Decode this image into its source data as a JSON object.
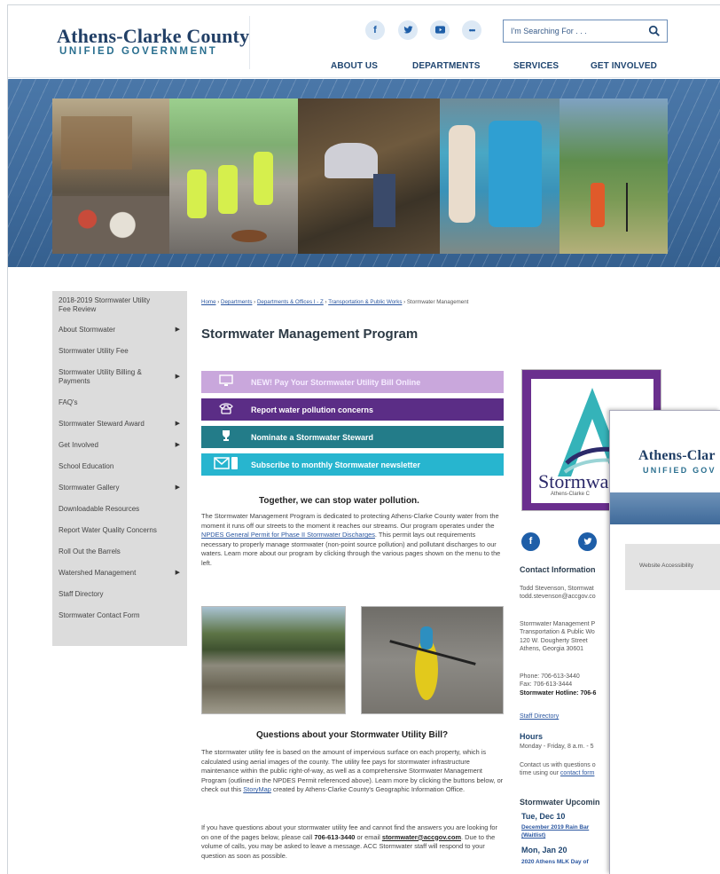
{
  "header": {
    "logo_line1": "Athens-Clarke County",
    "logo_line2": "UNIFIED GOVERNMENT",
    "social": [
      {
        "icon": "facebook-icon",
        "glyph": "f"
      },
      {
        "icon": "twitter-icon",
        "glyph": "🐦"
      },
      {
        "icon": "youtube-icon",
        "glyph": "▶"
      },
      {
        "icon": "more-icon",
        "glyph": "•••"
      }
    ],
    "search_placeholder": "I'm Searching For . . .",
    "nav": [
      "ABOUT US",
      "DEPARTMENTS",
      "SERVICES",
      "GET INVOLVED"
    ]
  },
  "sidebar": {
    "items": [
      {
        "label": "2018-2019 Stormwater Utility Fee Review",
        "arrow": false
      },
      {
        "label": "About Stormwater",
        "arrow": true
      },
      {
        "label": "Stormwater Utility Fee",
        "arrow": false
      },
      {
        "label": "Stormwater Utility Billing & Payments",
        "arrow": true
      },
      {
        "label": "FAQ's",
        "arrow": false
      },
      {
        "label": "Stormwater Steward Award",
        "arrow": true
      },
      {
        "label": "Get Involved",
        "arrow": true
      },
      {
        "label": "School Education",
        "arrow": false
      },
      {
        "label": "Stormwater Gallery",
        "arrow": true
      },
      {
        "label": "Downloadable Resources",
        "arrow": false
      },
      {
        "label": "Report Water Quality Concerns",
        "arrow": false
      },
      {
        "label": "Roll Out the Barrels",
        "arrow": false
      },
      {
        "label": "Watershed Management",
        "arrow": true
      },
      {
        "label": "Staff Directory",
        "arrow": false
      },
      {
        "label": "Stormwater Contact Form",
        "arrow": false
      }
    ]
  },
  "breadcrumb": {
    "home": "Home",
    "departments": "Departments",
    "offices": "Departments & Offices I - Z",
    "transport": "Transportation & Public Works",
    "current": "Stormwater Management"
  },
  "main": {
    "title": "Stormwater Management Program",
    "buttons": [
      {
        "label": "NEW! Pay Your Stormwater Utility Bill Online",
        "color": "#c9a7dc",
        "text": "#f5ecff",
        "icon": "computer-icon"
      },
      {
        "label": "Report water pollution concerns",
        "color": "#5b2d86",
        "text": "#ffffff",
        "icon": "telephone-icon"
      },
      {
        "label": "Nominate a Stormwater Steward",
        "color": "#237c89",
        "text": "#ffffff",
        "icon": "trophy-icon"
      },
      {
        "label": "Subscribe to monthly Stormwater newsletter",
        "color": "#27b5cf",
        "text": "#ffffff",
        "icon": "mail-icon"
      }
    ],
    "together_heading": "Together, we can stop water pollution.",
    "para1_a": "The Stormwater Management Program is dedicated to protecting Athens-Clarke County water from the moment it runs off our streets to the moment it reaches our streams. Our program operates under the ",
    "para1_link": "NPDES General Permit for Phase II Stormwater Discharges",
    "para1_b": ". This permit lays out requirements necessary to properly manage stormwater (non-point source pollution) and pollutant discharges to our waters. Learn more about our program by clicking through the various pages shown on the menu to the left.",
    "questions_heading": "Questions about your Stormwater Utility Bill?",
    "para2_a": "The stormwater utility fee is based on the amount of impervious surface on each property, which is calculated using aerial images of the county. The utility fee pays for stormwater infrastructure maintenance within the public right-of-way, as well as a comprehensive Stormwater Management Program (outlined in the NPDES Permit referenced above). Learn more by clicking the buttons below, or check out this ",
    "para2_link": "StoryMap",
    "para2_b": " created by Athens-Clarke County's Geographic Information Office.",
    "para3_a": "If you have questions about your stormwater utility fee and cannot find the answers you are looking for on one of the pages below, please call ",
    "para3_phone": "706-613-3440",
    "para3_b": " or email ",
    "para3_email": "stormwater@accgov.com",
    "para3_c": ". Due to the volume of calls, you may be asked to leave a message. ACC Stormwater staff will respond to your question as soon as possible."
  },
  "right": {
    "logo_word": "Stormwa",
    "logo_sub": "Athens-Clarke C",
    "contact_heading": "Contact Information",
    "contact_lines": [
      "Todd Stevenson, Stormwat",
      "todd.stevenson@accgov.co"
    ],
    "address_lines": [
      "Stormwater Management P",
      "Transportation & Public Wo",
      "120 W. Dougherty Street",
      "Athens, Georgia  30601"
    ],
    "phone": "Phone: 706-613-3440",
    "fax": "Fax: 706-613-3444",
    "hotline": "Stormwater Hotline: 706-6",
    "staff_directory": "Staff Directory",
    "hours_heading": "Hours",
    "hours_line": "Monday - Friday, 8 a.m. - 5",
    "contact_us_a": "Contact us with questions o",
    "contact_us_b": "time using our ",
    "contact_us_link": "contact form",
    "upcoming_heading": "Stormwater Upcomin",
    "events": [
      {
        "date": "Tue, Dec 10",
        "title": "December 2019 Rain Bar",
        "sub": "(Waitlist)"
      },
      {
        "date": "Mon, Jan 20",
        "title": "2020 Athens MLK Day of",
        "sub": ""
      }
    ]
  },
  "popup": {
    "logo_line1": "Athens-Clar",
    "logo_line2": "UNIFIED GOV",
    "menu_item": "Website Accessibility"
  }
}
